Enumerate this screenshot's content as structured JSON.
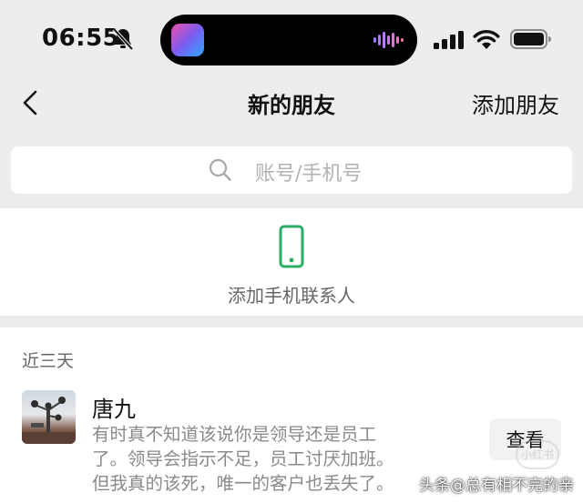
{
  "status_bar": {
    "time": "06:55",
    "icons": [
      "bell-slash-icon",
      "signal-icon",
      "wifi-icon",
      "battery-icon"
    ]
  },
  "nav": {
    "title": "新的朋友",
    "action": "添加朋友",
    "back_icon": "chevron-left-icon"
  },
  "search": {
    "placeholder": "账号/手机号",
    "icon": "search-icon"
  },
  "phone_contacts": {
    "label": "添加手机联系人",
    "icon": "phone-icon",
    "icon_color": "#2aae67"
  },
  "section": {
    "label": "近三天"
  },
  "requests": [
    {
      "name": "唐九",
      "message": "有时真不知道该说你是领导还是员工\n了。领导会指示不足，员工讨厌加班。\n但我真的该死，唯一的客户也丢失了。",
      "button": "查看"
    }
  ],
  "watermark": {
    "badge": "小红书",
    "text": "头条@总有相不完的亲"
  }
}
